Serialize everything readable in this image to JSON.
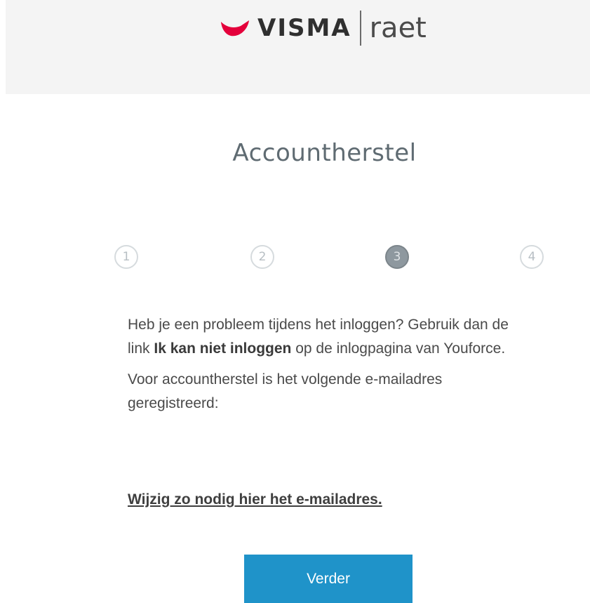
{
  "brand": {
    "visma": "VISMA",
    "raet": "raet",
    "swoosh_color": "#e4003b"
  },
  "page": {
    "title": "Accountherstel"
  },
  "steps": {
    "items": [
      "1",
      "2",
      "3",
      "4"
    ],
    "current": 3
  },
  "content": {
    "para1_part1": "Heb je een probleem tijdens het inloggen? Gebruik dan de link ",
    "para1_link": "Ik kan niet inloggen",
    "para1_part2": " op de inlogpagina van Youforce.",
    "para2": "Voor accountherstel is het volgende e-mailadres geregistreerd:"
  },
  "change_link": "Wijzig zo nodig hier het e-mailadres.",
  "next_button": "Verder",
  "colors": {
    "header_bg": "#f4f4f4",
    "title": "#5f6b72",
    "button_bg": "#1f93c9"
  }
}
